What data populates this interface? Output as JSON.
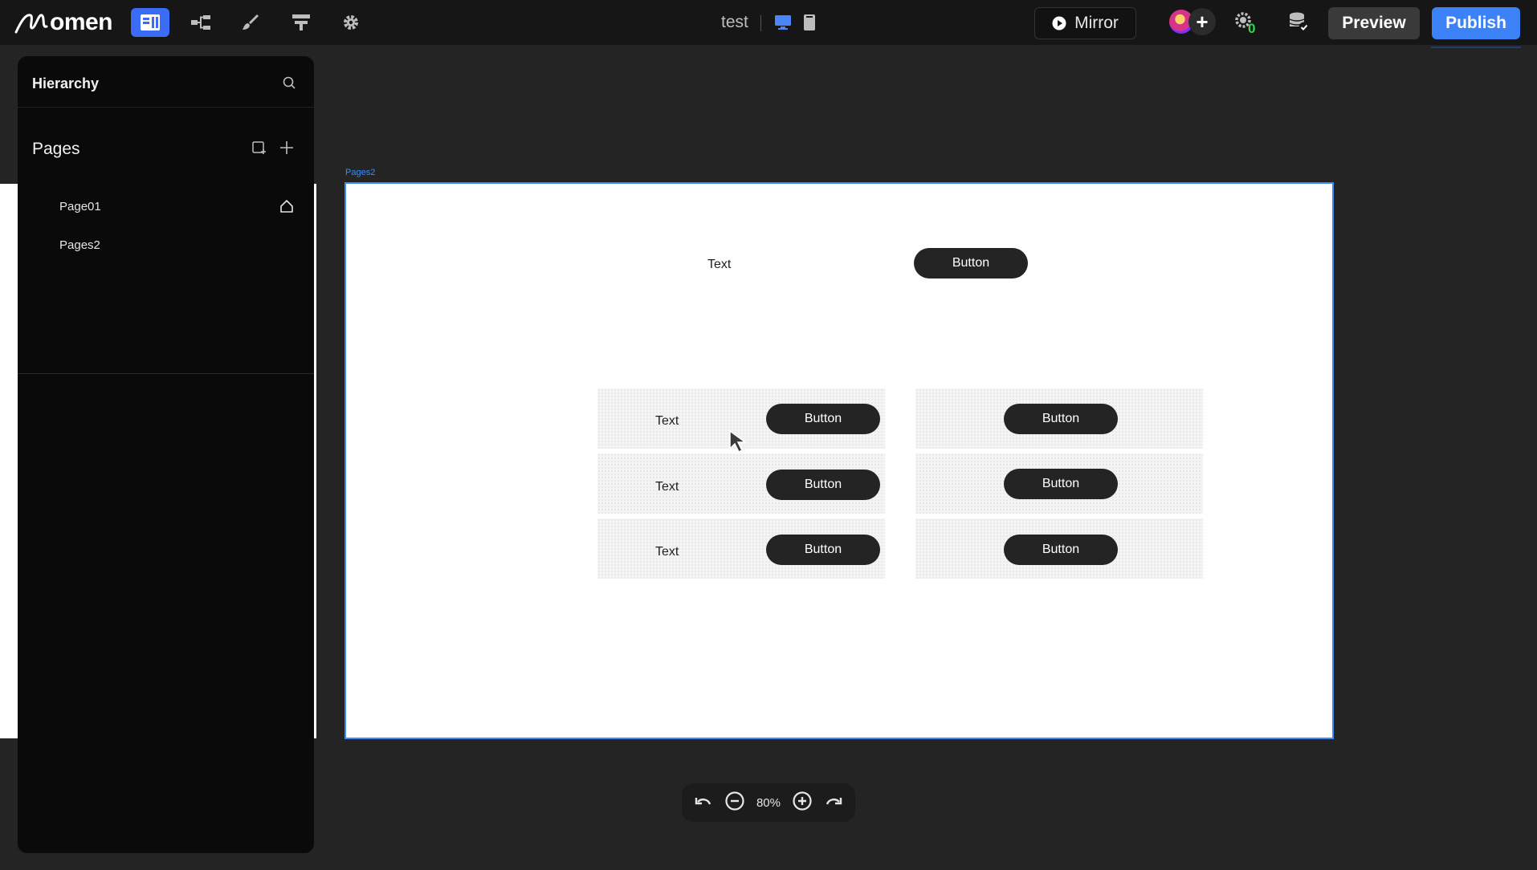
{
  "topbar": {
    "logo_text": "omen",
    "doc_title": "test",
    "mirror_label": "Mirror",
    "notification_count": "0",
    "preview_label": "Preview",
    "publish_label": "Publish",
    "accent": "#3b82f6"
  },
  "sidebar": {
    "title": "Hierarchy",
    "pages_title": "Pages",
    "pages": [
      {
        "label": "Page01",
        "is_home": true
      },
      {
        "label": "Pages2",
        "is_home": false
      }
    ]
  },
  "canvas": {
    "frame_label": "Pages2",
    "top_text": "Text",
    "top_button": "Button",
    "left_column": [
      {
        "text": "Text",
        "button": "Button"
      },
      {
        "text": "Text",
        "button": "Button"
      },
      {
        "text": "Text",
        "button": "Button"
      }
    ],
    "right_column": [
      {
        "button": "Button"
      },
      {
        "button": "Button"
      },
      {
        "button": "Button"
      }
    ]
  },
  "zoom": {
    "value": "80%"
  },
  "icons": [
    "logo-icon",
    "pages-icon",
    "hierarchy-icon",
    "brush-icon",
    "layout-icon",
    "gear-icon",
    "desktop-icon",
    "mobile-icon",
    "play-icon",
    "bug-icon",
    "database-check-icon",
    "search-icon",
    "add-folder-icon",
    "plus-icon",
    "home-icon",
    "undo-icon",
    "zoom-out-icon",
    "zoom-in-icon",
    "redo-icon",
    "cursor-icon"
  ]
}
